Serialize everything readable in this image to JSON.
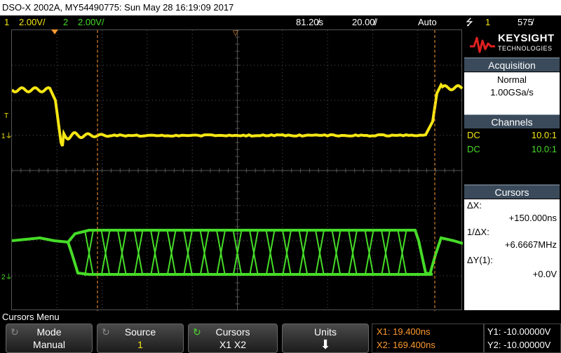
{
  "title": "DSO-X 2002A, MY54490775: Sun May 28 16:19:09 2017",
  "status": {
    "ch1_num": "1",
    "ch1_scale": "2.00V/",
    "ch2_num": "2",
    "ch2_scale": "2.00V/",
    "delay": "81.20̸s",
    "timebase": "20.00̸/",
    "trigger_mode": "Auto",
    "trigger_icon": "rising-edge-trigger",
    "trigger_source": "1",
    "trigger_level": "575̸"
  },
  "colors": {
    "ch1": "#f5e614",
    "ch2": "#46dc28",
    "cursor": "#ff9a2e",
    "grid": "#555555"
  },
  "brand": {
    "name": "KEYSIGHT",
    "subtitle": "TECHNOLOGIES"
  },
  "acquisition": {
    "header": "Acquisition",
    "mode": "Normal",
    "rate": "1.00GSa/s"
  },
  "channels": {
    "header": "Channels",
    "rows": [
      {
        "coupling": "DC",
        "probe": "10.0:1"
      },
      {
        "coupling": "DC",
        "probe": "10.0:1"
      }
    ]
  },
  "cursors": {
    "header": "Cursors",
    "dx_label": "ΔX:",
    "dx_value": "+150.000ns",
    "inv_dx_label": "1/ΔX:",
    "inv_dx_value": "+6.6667MHz",
    "dy_label": "ΔY(1):",
    "dy_value": "+0.0V"
  },
  "markers": {
    "trigger_t": "T",
    "ch1_marker": "1",
    "ch2_marker": "2"
  },
  "menu": {
    "title": "Cursors Menu",
    "softkeys": [
      {
        "label": "Mode",
        "value": "Manual",
        "icon": "rotate-knob-icon"
      },
      {
        "label": "Source",
        "value": "1",
        "icon": "rotate-knob-icon"
      },
      {
        "label": "Cursors",
        "value": "X1 X2",
        "icon": "rotate-knob-icon"
      },
      {
        "label": "Units",
        "value": "",
        "icon": "down-arrow-icon"
      }
    ],
    "x1": "X1: 19.400ns",
    "x2": "X2: 169.400ns",
    "y1": "Y1: -10.00000V",
    "y2": "Y2: -10.00000V"
  }
}
